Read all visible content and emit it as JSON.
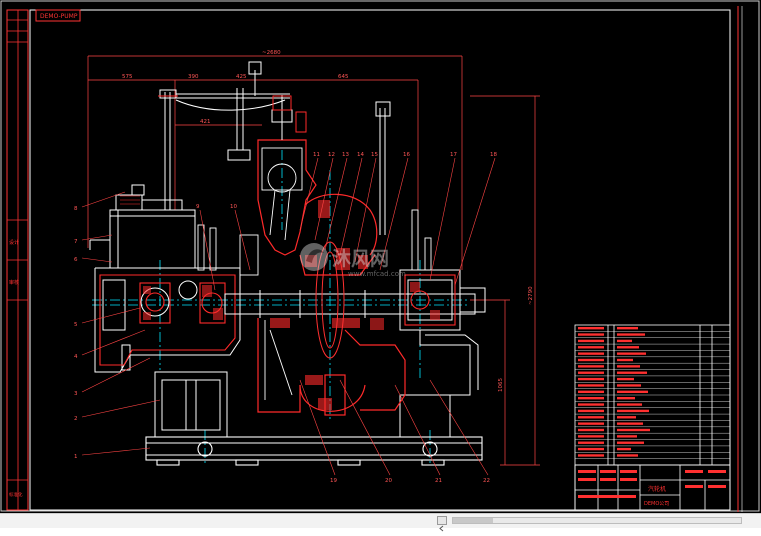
{
  "drawing": {
    "title_tab": "DEMO-PUMP"
  },
  "left_margin": {
    "labels": [
      "设计",
      "审核",
      "标准化"
    ]
  },
  "dimensions": {
    "overall_width": "~2680",
    "left_segment": "575",
    "seg_2": "390",
    "seg_3": "425",
    "seg_4": "645",
    "seg_5": "421",
    "overall_height": "~2790",
    "lower_height": "1065"
  },
  "callouts": {
    "left": [
      "8",
      "7",
      "6",
      "5",
      "4",
      "3",
      "2",
      "1"
    ],
    "top": [
      "9",
      "10",
      "11",
      "12",
      "13",
      "14",
      "15",
      "16",
      "17",
      "18"
    ],
    "bottom": [
      "19",
      "20",
      "21",
      "22",
      "23"
    ]
  },
  "title_block": {
    "name": "汽轮机",
    "company": "DEMO公司"
  },
  "watermark": {
    "brand": "沐风网",
    "url": "www.mfcad.com"
  },
  "colors": {
    "background": "#000000",
    "line_main": "#ff2222",
    "line_white": "#ffffff",
    "line_cyan": "#00e5ff",
    "hatch": "#ff3030"
  },
  "bottom_bar": {
    "scroll_position": 0.0
  }
}
